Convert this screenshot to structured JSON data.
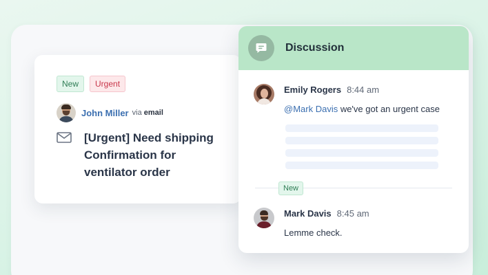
{
  "ticket": {
    "tags": {
      "new": "New",
      "urgent": "Urgent"
    },
    "requester": {
      "name": "John Miller",
      "via_prefix": "via",
      "via_channel": "email"
    },
    "subject": "[Urgent] Need shipping Confirmation for ventilator order",
    "icon": "mail-icon"
  },
  "discussion": {
    "title": "Discussion",
    "icon": "chat-bubble-icon",
    "messages": [
      {
        "author": "Emily Rogers",
        "time": "8:44 am",
        "mention": "@Mark Davis",
        "text": " we've got an urgent case"
      },
      {
        "author": "Mark Davis",
        "time": "8:45 am",
        "text": "Lemme check."
      }
    ],
    "new_divider_label": "New"
  },
  "colors": {
    "header_green": "#b9e6c8",
    "link_blue": "#3b6fb0",
    "urgent_red": "#c8364a",
    "new_green": "#2e7d55"
  }
}
